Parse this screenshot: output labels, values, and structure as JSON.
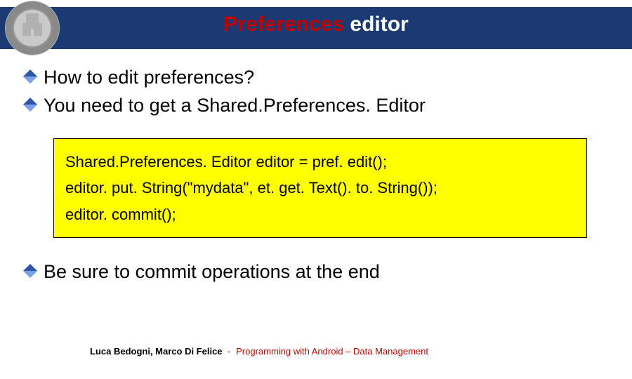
{
  "header": {
    "title_accent": "Preferences",
    "title_rest": " editor"
  },
  "bullets": {
    "b1": "How to edit preferences?",
    "b2": "You need to get a Shared.Preferences. Editor",
    "b3": "Be sure to commit operations at the end"
  },
  "code": {
    "line1": "Shared.Preferences. Editor editor = pref. edit();",
    "line2": "editor. put. String(\"mydata\", et. get. Text(). to. String());",
    "line3": "editor. commit();"
  },
  "footer": {
    "authors": "Luca Bedogni, Marco Di Felice",
    "sep": " - ",
    "course": "Programming with Android – Data Management"
  }
}
